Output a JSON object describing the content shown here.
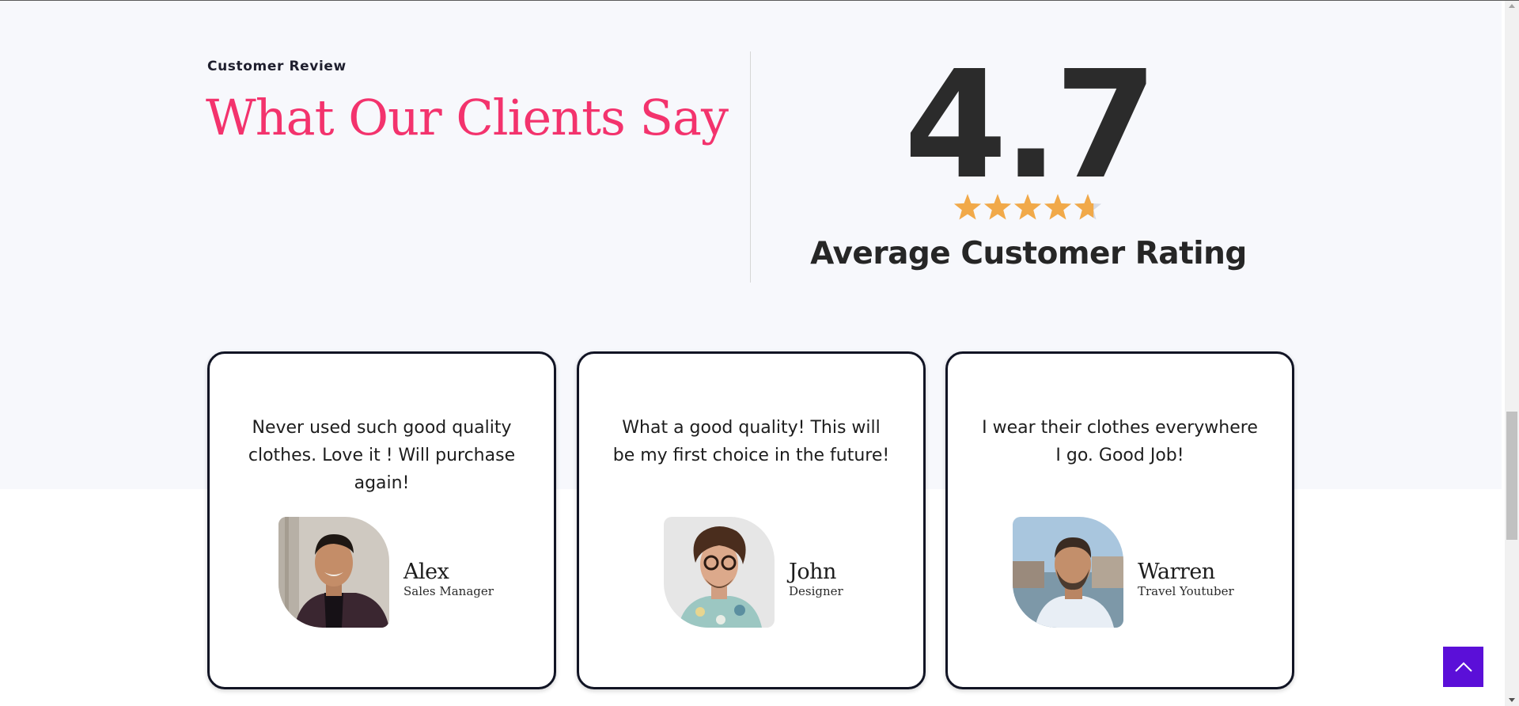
{
  "section": {
    "eyebrow": "Customer Review",
    "heading": "What Our Clients Say"
  },
  "rating": {
    "value": "4.7",
    "stars_filled": 4.7,
    "stars_total": 5,
    "label": "Average Customer Rating"
  },
  "colors": {
    "heading": "#f3336d",
    "star": "#f1a949",
    "star_empty": "#d8dbe4",
    "card_border": "#111424",
    "back_to_top": "#5b0fd8"
  },
  "testimonials": [
    {
      "quote": "Never used such good quality clothes. Love it ! Will purchase again!",
      "name": "Alex",
      "role": "Sales Manager"
    },
    {
      "quote": "What a good quality! This will be my first choice in the future!",
      "name": "John",
      "role": "Designer"
    },
    {
      "quote": "I wear their clothes everywhere I go. Good Job!",
      "name": "Warren",
      "role": "Travel Youtuber"
    }
  ],
  "icons": {
    "star": "star-icon",
    "back_to_top": "chevron-up-icon"
  }
}
